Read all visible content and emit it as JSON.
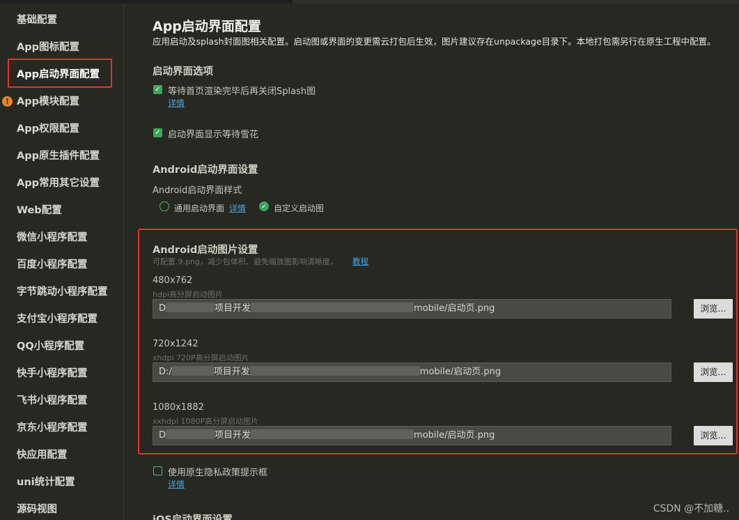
{
  "sidebar": {
    "items": [
      {
        "label": "基础配置"
      },
      {
        "label": "App图标配置"
      },
      {
        "label": "App启动界面配置"
      },
      {
        "label": "App模块配置"
      },
      {
        "label": "App权限配置"
      },
      {
        "label": "App原生插件配置"
      },
      {
        "label": "App常用其它设置"
      },
      {
        "label": "Web配置"
      },
      {
        "label": "微信小程序配置"
      },
      {
        "label": "百度小程序配置"
      },
      {
        "label": "字节跳动小程序配置"
      },
      {
        "label": "支付宝小程序配置"
      },
      {
        "label": "QQ小程序配置"
      },
      {
        "label": "快手小程序配置"
      },
      {
        "label": "飞书小程序配置"
      },
      {
        "label": "京东小程序配置"
      },
      {
        "label": "快应用配置"
      },
      {
        "label": "uni统计配置"
      },
      {
        "label": "源码视图"
      }
    ],
    "warning_icon": "!"
  },
  "main": {
    "title": "App启动界面配置",
    "description": "应用启动及splash封面图相关配置。启动图或界面的变更需云打包后生效，图片建议存在unpackage目录下。本地打包需另行在原生工程中配置。",
    "options_heading": "启动界面选项",
    "opt1_label": "等待首页渲染完毕后再关闭Splash图",
    "opt1_link": "详情",
    "opt2_label": "启动界面显示等待雪花",
    "android_heading": "Android启动界面设置",
    "android_style_label": "Android启动界面样式",
    "radio_general": "通用启动界面",
    "radio_general_link": "详情",
    "radio_custom": "自定义启动图",
    "image_heading": "Android启动图片设置",
    "image_hint": "可配置.9.png，减少包体积、避免缩放图影响清晰度，",
    "image_hint_link": "教程",
    "images": [
      {
        "size": "480x762",
        "hint": "hdpi高分屏启动图片",
        "path_start": "D",
        "path_mid": "项目开发",
        "path_end": "mobile/启动页.png",
        "browse": "浏览..."
      },
      {
        "size": "720x1242",
        "hint": "xhdpi 720P高分屏启动图片",
        "path_start": "D:/",
        "path_mid": "项目开发",
        "path_end": "mobile/启动页.png",
        "browse": "浏览..."
      },
      {
        "size": "1080x1882",
        "hint": "xxhdpi 1080P高分屏启动图片",
        "path_start": "D",
        "path_mid": "项目开发",
        "path_end": "mobile/启动页.png",
        "browse": "浏览..."
      }
    ],
    "privacy_label": "使用原生隐私政策提示框",
    "privacy_link": "详情",
    "ios_heading": "iOS启动界面设置"
  },
  "watermark": "CSDN @不加糖.."
}
